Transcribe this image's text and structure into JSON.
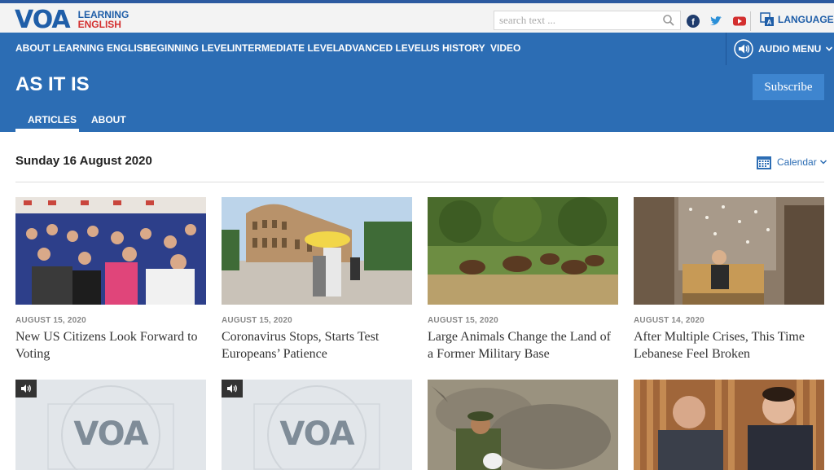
{
  "brand": {
    "logo_mark": "VOA",
    "line1": "LEARNING",
    "line2": "ENGLISH"
  },
  "search": {
    "placeholder": "search text ..."
  },
  "languages_label": "LANGUAGES",
  "nav": {
    "items": [
      "ABOUT LEARNING ENGLISH",
      "BEGINNING LEVEL",
      "INTERMEDIATE LEVEL",
      "ADVANCED LEVEL",
      "US HISTORY",
      "VIDEO"
    ],
    "audio_menu": "AUDIO MENU"
  },
  "header": {
    "title": "AS IT IS",
    "subscribe": "Subscribe",
    "tabs": [
      "ARTICLES",
      "ABOUT"
    ]
  },
  "main": {
    "date_heading": "Sunday 16 August 2020",
    "calendar_label": "Calendar",
    "cards": [
      {
        "date": "AUGUST 15, 2020",
        "title": "New US Citizens Look Forward to Voting"
      },
      {
        "date": "AUGUST 15, 2020",
        "title": "Coronavirus Stops, Starts Test Europeans’ Patience"
      },
      {
        "date": "AUGUST 15, 2020",
        "title": "Large Animals Change the Land of a Former Military Base"
      },
      {
        "date": "AUGUST 14, 2020",
        "title": "After Multiple Crises, This Time Lebanese Feel Broken"
      }
    ],
    "row2_logo": "VOA"
  },
  "colors": {
    "brand_blue": "#2c6db4",
    "accent_red": "#d32f2f"
  },
  "icons": [
    "search-icon",
    "facebook-icon",
    "twitter-icon",
    "youtube-icon",
    "languages-icon",
    "speaker-icon",
    "chevron-down-icon",
    "calendar-icon"
  ]
}
